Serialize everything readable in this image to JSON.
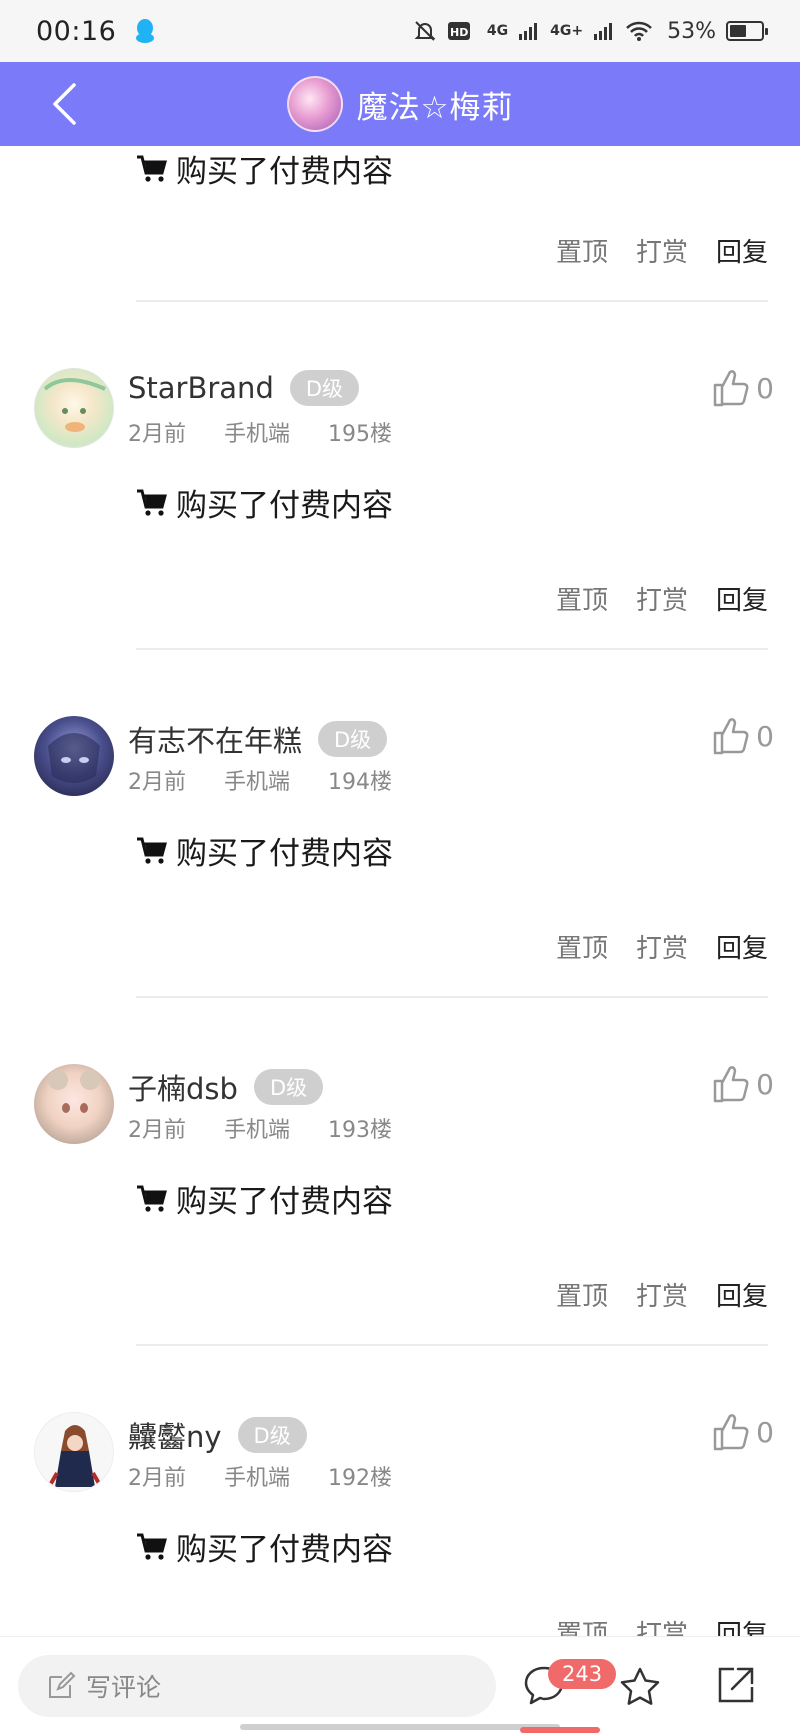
{
  "status": {
    "time": "00:16",
    "signal1": "4G",
    "signal2": "4G+",
    "battery": "53%",
    "battery_level": 0.53
  },
  "header": {
    "title": "魔法☆梅莉"
  },
  "actions": {
    "pin": "置顶",
    "reward": "打赏",
    "reply": "回复"
  },
  "paid_text": "购买了付费内容",
  "posts": [
    {
      "username": "StarBrand",
      "level": "D级",
      "time": "2月前",
      "device": "手机端",
      "floor": "195楼",
      "likes": "0"
    },
    {
      "username": "有志不在年糕",
      "level": "D级",
      "time": "2月前",
      "device": "手机端",
      "floor": "194楼",
      "likes": "0"
    },
    {
      "username": "子楠dsb",
      "level": "D级",
      "time": "2月前",
      "device": "手机端",
      "floor": "193楼",
      "likes": "0"
    },
    {
      "username": "齉齾ny",
      "level": "D级",
      "time": "2月前",
      "device": "手机端",
      "floor": "192楼",
      "likes": "0"
    }
  ],
  "bottom": {
    "comment_placeholder": "写评论",
    "comment_count": "243"
  }
}
